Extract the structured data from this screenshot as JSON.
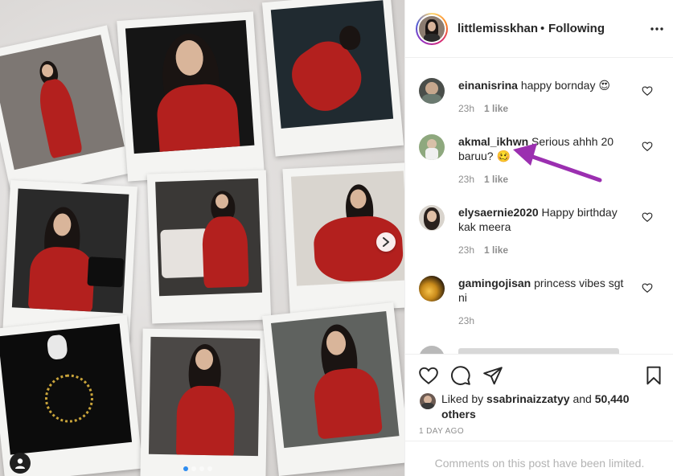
{
  "post": {
    "username": "littlemisskhan",
    "separator": "•",
    "follow_status": "Following"
  },
  "comments": [
    {
      "username": "einanisrina",
      "text": "happy bornday 😍",
      "time": "23h",
      "likes": "1 like"
    },
    {
      "username": "akmal_ikhwn",
      "text": "Serious ahhh 20 baruu? 🥴",
      "time": "23h",
      "likes": "1 like"
    },
    {
      "username": "elysaernie2020",
      "text": "Happy birthday kak meera",
      "time": "23h",
      "likes": "1 like"
    },
    {
      "username": "gamingojisan",
      "text": "princess vibes sgt ni",
      "time": "23h",
      "likes": ""
    }
  ],
  "likes": {
    "prefix": "Liked by",
    "user": "ssabrinaizzatyy",
    "and": "and",
    "others": "50,440 others"
  },
  "post_date": "1 DAY AGO",
  "comments_limited": "Comments on this post have been limited.",
  "colors": {
    "annotation_arrow": "#9b2fb0",
    "dress_red": "#b3201e",
    "carousel_active_dot": "#2d8cf0"
  },
  "carousel": {
    "total": 4,
    "active": 1
  },
  "icons": [
    "next-arrow-icon",
    "user-tag-icon",
    "more-options-icon",
    "heart-icon",
    "comment-icon",
    "share-icon",
    "bookmark-icon"
  ]
}
